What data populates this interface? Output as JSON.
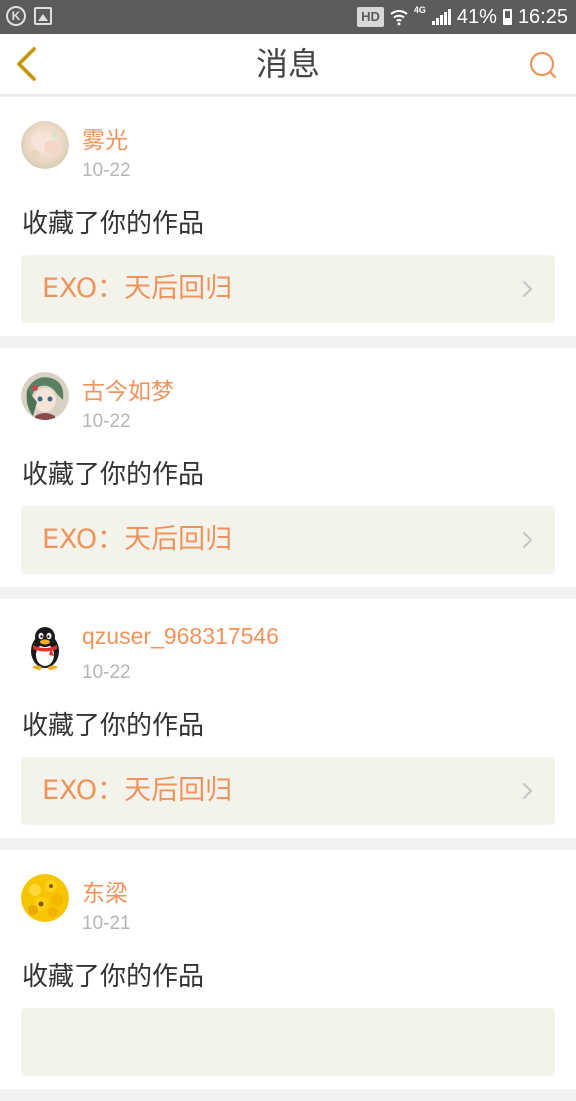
{
  "status_bar": {
    "left_icons": [
      "k-app-icon",
      "gallery-icon"
    ],
    "hd": "HD",
    "network": "4G",
    "battery": "41%",
    "time": "16:25"
  },
  "header": {
    "title": "消息"
  },
  "colors": {
    "accent": "#f0935a",
    "status_bar": "#5c5c5c",
    "card_link_bg": "#f3f3ec"
  },
  "messages": [
    {
      "user": "雾光",
      "date": "10-22",
      "action": "收藏了你的作品",
      "work": "EXO：天后回归",
      "avatar": "flower-avatar"
    },
    {
      "user": "古今如梦",
      "date": "10-22",
      "action": "收藏了你的作品",
      "work": "EXO：天后回归",
      "avatar": "anime-avatar"
    },
    {
      "user": "qzuser_968317546",
      "date": "10-22",
      "action": "收藏了你的作品",
      "work": "EXO：天后回归",
      "avatar": "qq-penguin-avatar"
    },
    {
      "user": "东梁",
      "date": "10-21",
      "action": "收藏了你的作品",
      "work": "",
      "avatar": "sunflower-avatar"
    }
  ]
}
